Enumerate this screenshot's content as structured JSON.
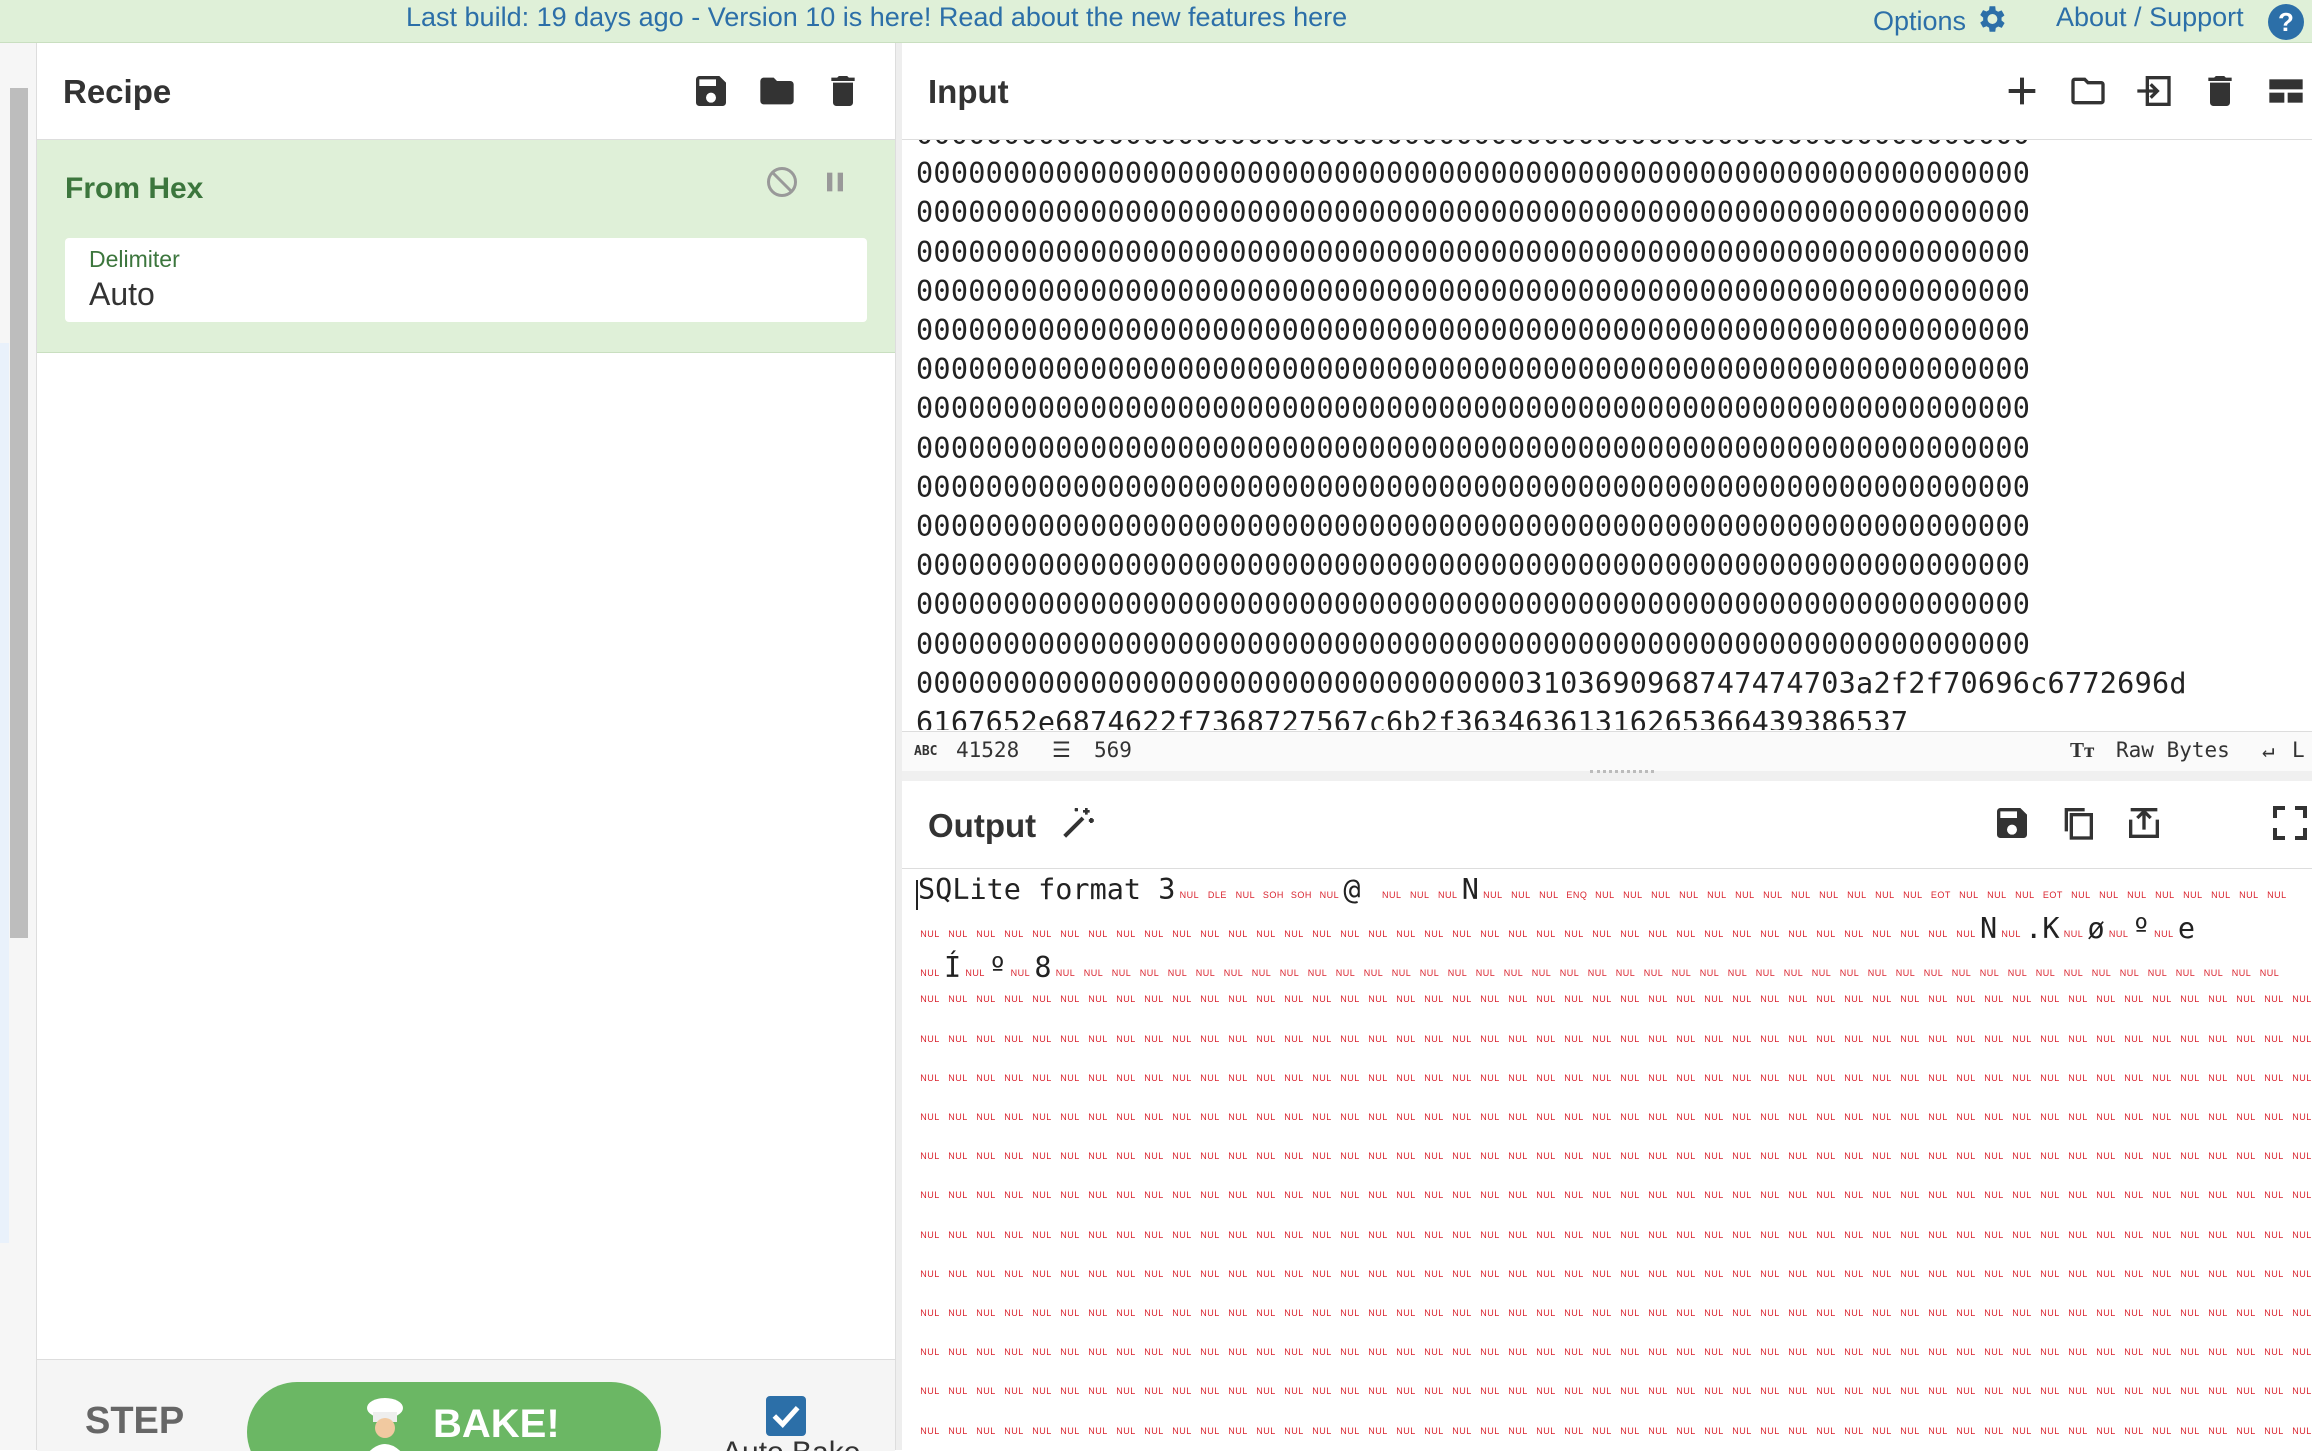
{
  "banner": {
    "message": "Last build: 19 days ago - Version 10 is here! Read about the new features ",
    "link": "here",
    "options": "Options",
    "about": "About / Support",
    "help_glyph": "?"
  },
  "recipe": {
    "title": "Recipe",
    "icons": [
      "save-icon",
      "folder-icon",
      "trash-icon"
    ],
    "operation": {
      "name": "From Hex",
      "disable_icon": "disable-icon",
      "pause_icon": "pause-icon",
      "field_label": "Delimiter",
      "field_value": "Auto"
    },
    "controls": {
      "step": "STEP",
      "bake": "BAKE!",
      "auto_bake": "Auto Bake",
      "auto_bake_checked": true
    }
  },
  "input": {
    "title": "Input",
    "icons": [
      "plus-icon",
      "folder-icon",
      "load-icon",
      "trash-icon",
      "layout-icon"
    ],
    "lines": [
      "0000000000000000000000000000000000000000000000000000000000000000",
      "0000000000000000000000000000000000000000000000000000000000000000",
      "0000000000000000000000000000000000000000000000000000000000000000",
      "0000000000000000000000000000000000000000000000000000000000000000",
      "0000000000000000000000000000000000000000000000000000000000000000",
      "0000000000000000000000000000000000000000000000000000000000000000",
      "0000000000000000000000000000000000000000000000000000000000000000",
      "0000000000000000000000000000000000000000000000000000000000000000",
      "0000000000000000000000000000000000000000000000000000000000000000",
      "0000000000000000000000000000000000000000000000000000000000000000",
      "0000000000000000000000000000000000000000000000000000000000000000",
      "0000000000000000000000000000000000000000000000000000000000000000",
      "0000000000000000000000000000000000000000000000000000000000000000",
      "0000000000000000000000000000000000000000000000000000000000000000",
      "000000000000000000000000000000000003103690968747474703a2f2f70696c6772696d",
      "6167652e6874622f7368727567c6b2f36346361316265366439386537"
    ],
    "status": {
      "length_label": "ABC",
      "length": "41528",
      "lines_count": "569",
      "encoding": "Raw Bytes",
      "eol": "L"
    }
  },
  "output": {
    "title": "Output",
    "icons": [
      "magic-wand-icon",
      "save-icon",
      "copy-icon",
      "replace-input-icon",
      "maximize-icon"
    ],
    "first_line_text": "SQLite format 3",
    "line1_ctrl": [
      "NUL",
      "DLE",
      "NUL",
      "SOH",
      "SOH",
      "NUL"
    ],
    "line1_tail_ctrl": [
      "NUL",
      "NUL",
      "NUL"
    ],
    "line1_ctrl2": [
      "NUL",
      "NUL",
      "NUL",
      "ENQ",
      "NUL",
      "NUL",
      "NUL",
      "NUL",
      "NUL",
      "NUL",
      "NUL",
      "NUL",
      "NUL",
      "NUL",
      "NUL",
      "NUL",
      "EOT",
      "NUL",
      "NUL",
      "NUL",
      "EOT",
      "NUL",
      "NUL",
      "NUL",
      "NUL",
      "NUL",
      "NUL",
      "NUL",
      "NUL"
    ],
    "ctrl_token": "NUL",
    "glyph_at": "@",
    "glyph_N": "N",
    "line2_tail": [
      ".K",
      "ø",
      "º",
      "e"
    ],
    "line3_chars": [
      "Í",
      "º",
      "8"
    ]
  }
}
